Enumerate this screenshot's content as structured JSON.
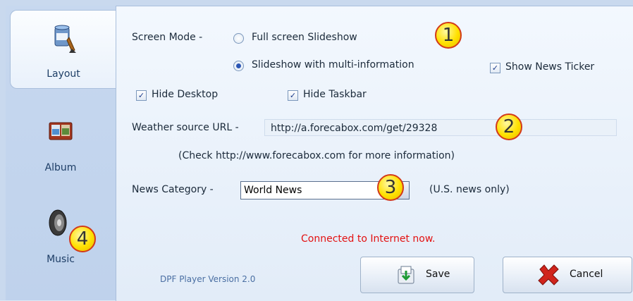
{
  "nav": {
    "items": [
      {
        "label": "Layout",
        "icon": "paint-bucket-icon",
        "active": true
      },
      {
        "label": "Album",
        "icon": "photo-album-icon",
        "active": false
      },
      {
        "label": "Music",
        "icon": "speaker-icon",
        "active": false
      }
    ]
  },
  "layout": {
    "screen_mode_label": "Screen Mode -",
    "option_fullscreen": "Full screen Slideshow",
    "option_multi": "Slideshow with multi-information",
    "show_news_ticker": "Show News Ticker",
    "hide_desktop": "Hide Desktop",
    "hide_taskbar": "Hide Taskbar",
    "weather_label": "Weather source URL -",
    "weather_url": "http://a.forecabox.com/get/29328",
    "weather_hint": "(Check http://www.forecabox.com for more information)",
    "news_label": "News Category -",
    "news_value": "World News",
    "news_note": "(U.S. news only)",
    "status": "Connected to Internet now.",
    "version": "DPF Player Version 2.0"
  },
  "buttons": {
    "save": "Save",
    "cancel": "Cancel"
  },
  "badges": [
    "1",
    "2",
    "3",
    "4"
  ],
  "colors": {
    "status_red": "#e31212",
    "version_blue": "#4b6fa3",
    "badge_yellow": "#ffe100",
    "badge_border": "#d23a1a"
  }
}
